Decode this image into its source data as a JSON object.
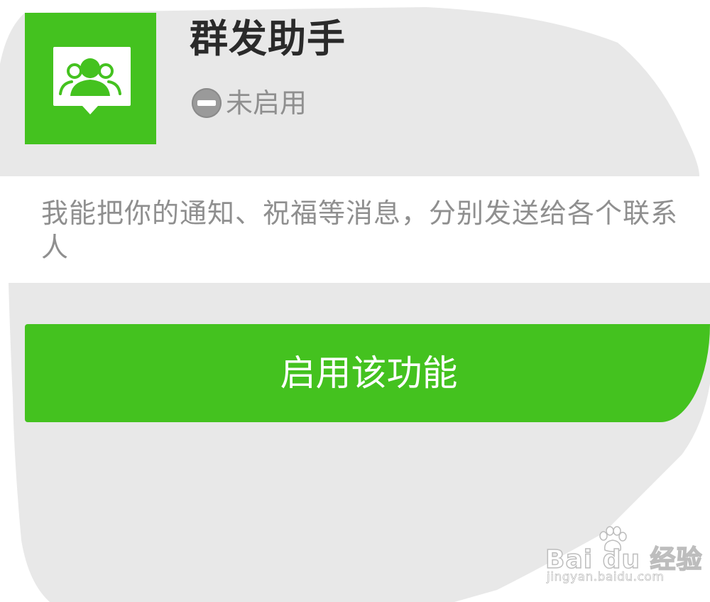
{
  "app": {
    "title": "群发助手",
    "status": "未启用",
    "description": "我能把你的通知、祝福等消息，分别发送给各个联系人",
    "icon": "group-message-icon",
    "status_icon": "disabled-icon"
  },
  "actions": {
    "enable_label": "启用该功能"
  },
  "watermark": {
    "logo": "Bai du 经验",
    "url": "jingyan.baidu.com"
  },
  "colors": {
    "accent": "#44c21f",
    "background_gray": "#e8e8e8",
    "title_text": "#2a2a2a",
    "secondary_text": "#8f8f8f"
  }
}
